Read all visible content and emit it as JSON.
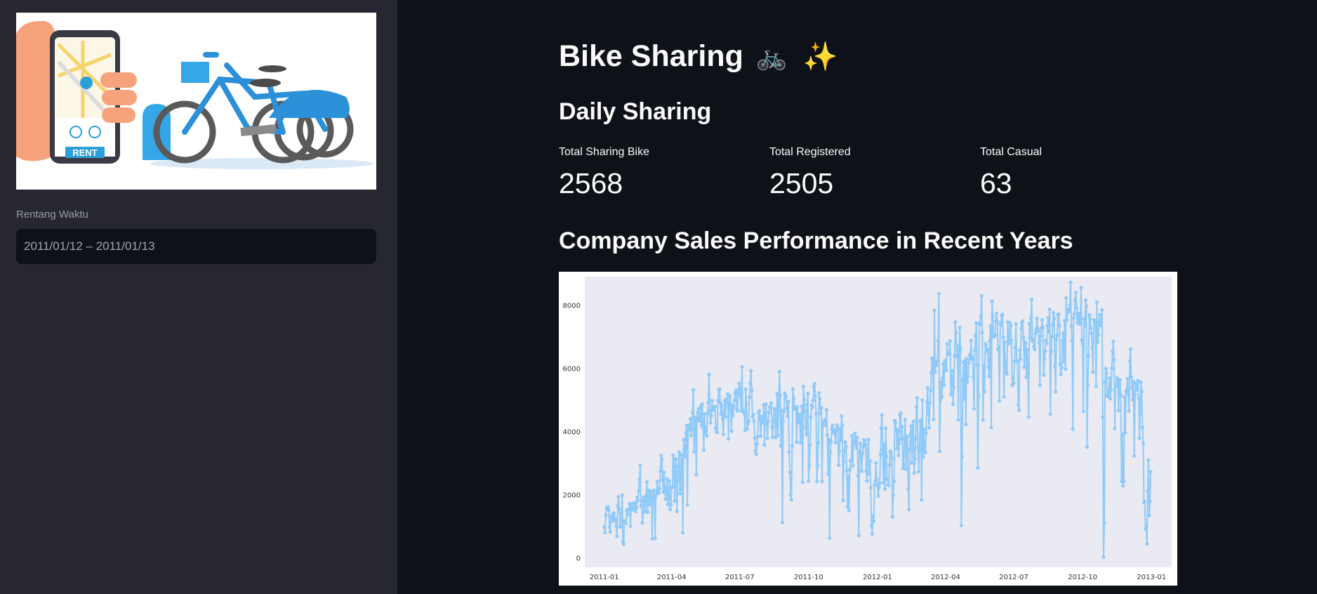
{
  "sidebar": {
    "hero_badge": "RENT",
    "date_range": {
      "label": "Rentang Waktu",
      "value": "2011/01/12 – 2011/01/13"
    }
  },
  "header": {
    "title": "Bike Sharing",
    "title_emoji_1": "🚲",
    "title_emoji_2": "✨"
  },
  "daily": {
    "heading": "Daily Sharing",
    "metrics": [
      {
        "label": "Total Sharing Bike",
        "value": "2568"
      },
      {
        "label": "Total Registered",
        "value": "2505"
      },
      {
        "label": "Total Casual",
        "value": "63"
      }
    ]
  },
  "colors": {
    "app_bg": "#0e1117",
    "sidebar_bg": "#262730",
    "series": "#90caf9",
    "plot_bg": "#eaeaf2"
  },
  "chart_section": {
    "title": "Company Sales Performance in Recent Years"
  },
  "chart_data": {
    "type": "line",
    "title": "",
    "xlabel": "",
    "ylabel": "",
    "ylim": [
      -300,
      8900
    ],
    "xlim": [
      "2010-12-06",
      "2013-01-28"
    ],
    "grid": false,
    "x_ticks": [
      "2011-01",
      "2011-04",
      "2011-07",
      "2011-10",
      "2012-01",
      "2012-04",
      "2012-07",
      "2012-10",
      "2013-01"
    ],
    "y_ticks": [
      0,
      2000,
      4000,
      6000,
      8000
    ],
    "series": [
      {
        "name": "",
        "marker": "o",
        "x_start": "2011-01-01",
        "x_step": "1 day",
        "values": [
          985,
          801,
          1349,
          1562,
          1600,
          1606,
          1510,
          959,
          822,
          1321,
          1263,
          1162,
          1406,
          1421,
          1248,
          1204,
          1000,
          683,
          1650,
          1927,
          1543,
          981,
          986,
          1416,
          1985,
          506,
          431,
          1167,
          1098,
          1096,
          1501,
          1360,
          1526,
          1550,
          1708,
          1005,
          1623,
          1712,
          1530,
          1605,
          1538,
          1746,
          1472,
          1589,
          1913,
          1815,
          2115,
          2475,
          2927,
          1635,
          1812,
          1107,
          1450,
          1917,
          1807,
          1461,
          1969,
          2402,
          1446,
          1851,
          2134,
          1685,
          1944,
          2077,
          605,
          1872,
          2133,
          1891,
          623,
          1977,
          2132,
          2417,
          2046,
          2056,
          2192,
          2744,
          3239,
          3117,
          2471,
          2077,
          2703,
          2121,
          1865,
          2210,
          2496,
          1693,
          2028,
          2425,
          1536,
          1685,
          2227,
          2252,
          3249,
          3115,
          1795,
          2808,
          3141,
          1471,
          2455,
          2895,
          3348,
          2034,
          2162,
          3267,
          3126,
          795,
          3744,
          3429,
          3204,
          3944,
          4189,
          1683,
          4036,
          4191,
          4073,
          4400,
          3872,
          4058,
          4595,
          5312,
          3351,
          4401,
          4451,
          2633,
          4433,
          4608,
          4714,
          4333,
          4362,
          4803,
          4182,
          4864,
          4105,
          3409,
          4553,
          3958,
          4123,
          3855,
          4575,
          4917,
          5805,
          4660,
          4274,
          4492,
          4978,
          4677,
          4679,
          4758,
          4788,
          4098,
          3982,
          3974,
          4968,
          5312,
          5342,
          4906,
          4548,
          4833,
          4401,
          3915,
          4586,
          4966,
          4460,
          5020,
          4891,
          5180,
          3767,
          4844,
          5119,
          4744,
          4010,
          4835,
          4507,
          4790,
          4991,
          5202,
          5305,
          4708,
          4648,
          5225,
          5515,
          5362,
          5119,
          4649,
          6043,
          4665,
          4629,
          4592,
          4040,
          5336,
          4881,
          4086,
          4258,
          4342,
          5084,
          5538,
          5923,
          5302,
          4458,
          4541,
          4332,
          3784,
          3387,
          3285,
          3606,
          3840,
          4590,
          4656,
          4390,
          3846,
          4475,
          4302,
          4266,
          4845,
          3574,
          4576,
          4866,
          4294,
          3785,
          4326,
          4602,
          4780,
          4792,
          4905,
          4150,
          3820,
          4338,
          4725,
          4694,
          3805,
          4153,
          5191,
          3873,
          4758,
          5895,
          5130,
          3542,
          4661,
          1115,
          4334,
          4634,
          5204,
          5058,
          5115,
          4727,
          4484,
          4940,
          3351,
          2710,
          1996,
          1842,
          3544,
          5345,
          5046,
          4713,
          4763,
          4785,
          3659,
          4760,
          4511,
          4274,
          4539,
          3641,
          4352,
          4795,
          2395,
          5423,
          5010,
          4630,
          4120,
          3907,
          4839,
          5202,
          2429,
          2918,
          3570,
          4456,
          4826,
          4765,
          4985,
          5409,
          5511,
          5117,
          4563,
          2416,
          2913,
          3644,
          5217,
          5041,
          4570,
          4748,
          2424,
          4195,
          4304,
          4308,
          4381,
          4187,
          4687,
          3894,
          2659,
          3747,
          627,
          3331,
          3669,
          4068,
          4186,
          3974,
          4046,
          3926,
          3649,
          4035,
          4205,
          4109,
          2933,
          3368,
          4067,
          3717,
          4486,
          4195,
          1817,
          3053,
          3392,
          3663,
          3520,
          2765,
          1607,
          2566,
          1495,
          2792,
          3068,
          3071,
          3867,
          2914,
          3613,
          3727,
          3940,
          3614,
          3485,
          3811,
          2594,
          705,
          3322,
          3620,
          3190,
          2743,
          3310,
          3523,
          3740,
          3709,
          3577,
          2739,
          2431,
          3403,
          3750,
          2660,
          3068,
          2209,
          1011,
          754,
          1317,
          1162,
          2302,
          2423,
          2999,
          2485,
          2294,
          1951,
          2236,
          2368,
          3272,
          4098,
          4521,
          3425,
          2376,
          3598,
          2177,
          4097,
          3214,
          2493,
          2311,
          2298,
          2935,
          3376,
          3292,
          3163,
          1301,
          1977,
          2432,
          4339,
          4270,
          4075,
          3456,
          4023,
          3243,
          3624,
          4509,
          4579,
          3761,
          4151,
          2832,
          2947,
          3784,
          4375,
          2802,
          3830,
          3831,
          2169,
          1529,
          3422,
          3922,
          4169,
          3005,
          4154,
          4318,
          2689,
          3129,
          3777,
          4773,
          5062,
          3487,
          2732,
          3389,
          4322,
          4363,
          1834,
          4990,
          3194,
          4066,
          3423,
          3333,
          3956,
          4916,
          5382,
          4569,
          4118,
          4911,
          5298,
          5847,
          6312,
          6192,
          4378,
          7836,
          5892,
          6153,
          6093,
          6230,
          6871,
          8362,
          3372,
          4996,
          5558,
          5102,
          5698,
          6133,
          5459,
          6235,
          6041,
          5936,
          6772,
          6436,
          6457,
          6460,
          6857,
          5169,
          5585,
          5918,
          4862,
          5409,
          6398,
          7460,
          7132,
          6370,
          6691,
          4367,
          6565,
          7290,
          6624,
          1027,
          3214,
          5633,
          6196,
          5026,
          6233,
          4220,
          6304,
          5572,
          5740,
          6169,
          6421,
          6296,
          6883,
          6359,
          6273,
          5728,
          4717,
          6572,
          7030,
          7429,
          6118,
          2843,
          5115,
          7424,
          7384,
          7639,
          8294,
          7129,
          4359,
          6073,
          5260,
          6770,
          6734,
          6536,
          6591,
          6043,
          5743,
          6855,
          7338,
          4127,
          8120,
          7641,
          6998,
          7001,
          7055,
          7494,
          7736,
          7498,
          6598,
          6664,
          4972,
          7421,
          7363,
          7665,
          7702,
          6978,
          5099,
          6825,
          6211,
          5905,
          5823,
          7458,
          6891,
          6779,
          7442,
          7335,
          6879,
          5463,
          5687,
          5531,
          6227,
          6660,
          7403,
          6241,
          6207,
          4840,
          4672,
          6569,
          6290,
          7264,
          7446,
          7499,
          6969,
          6031,
          6830,
          6786,
          5713,
          6591,
          5870,
          4459,
          7410,
          6966,
          7592,
          8173,
          6861,
          6904,
          6685,
          6597,
          7105,
          7216,
          7580,
          7261,
          7175,
          6824,
          5464,
          7013,
          7273,
          7534,
          7286,
          5786,
          6299,
          6544,
          6883,
          6784,
          7347,
          7605,
          7148,
          7865,
          4549,
          6530,
          7006,
          7375,
          7765,
          7582,
          6053,
          5255,
          6917,
          7040,
          7697,
          7713,
          7350,
          6140,
          5810,
          6034,
          6864,
          7112,
          6203,
          7504,
          5976,
          8227,
          7525,
          7767,
          7870,
          7804,
          8009,
          8714,
          7333,
          6869,
          4073,
          7591,
          7720,
          8167,
          8395,
          7907,
          7436,
          7538,
          7733,
          7393,
          7415,
          8555,
          6889,
          6778,
          4639,
          7572,
          7328,
          8156,
          7965,
          3510,
          5478,
          6392,
          7691,
          7570,
          7282,
          7109,
          6639,
          5875,
          7534,
          7461,
          7509,
          5424,
          8090,
          6824,
          7058,
          7466,
          7693,
          7359,
          7444,
          7852,
          4459,
          22,
          1096,
          5566,
          5986,
          5847,
          5138,
          5107,
          5259,
          5686,
          5035,
          5315,
          5992,
          6536,
          6852,
          6269,
          4094,
          5495,
          5445,
          5698,
          5629,
          4669,
          5499,
          5634,
          5146,
          2425,
          3910,
          2277,
          2424,
          5087,
          3959,
          5260,
          5323,
          5668,
          5191,
          4649,
          6234,
          6606,
          5729,
          5375,
          5008,
          5582,
          3228,
          5170,
          5501,
          5319,
          5532,
          5611,
          5047,
          3786,
          4585,
          5557,
          5267,
          4128,
          3623,
          1749,
          1787,
          920,
          1013,
          441,
          2114,
          3095,
          1341,
          1796,
          2729
        ]
      }
    ]
  }
}
